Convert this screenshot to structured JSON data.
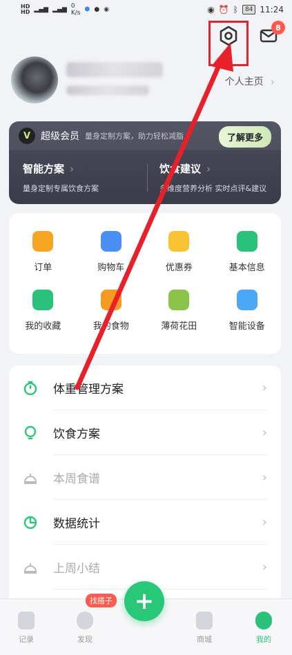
{
  "status_bar": {
    "time": "11:24",
    "battery": "84",
    "net_speed": "0",
    "net_unit": "K/s"
  },
  "header": {
    "mail_badge": "8"
  },
  "profile": {
    "home_link": "个人主页"
  },
  "vip": {
    "logo": "V",
    "title": "超级会员",
    "subtitle": "量身定制方案，助力轻松减脂",
    "more_label": "了解更多",
    "left_heading": "智能方案",
    "left_sub": "量身定制专属饮食方案",
    "right_heading": "饮食建议",
    "right_sub": "多维度营养分析 实时点评&建议"
  },
  "grid": {
    "items": [
      {
        "label": "订单",
        "icon": "order-icon",
        "color": "#f5a623"
      },
      {
        "label": "购物车",
        "icon": "cart-icon",
        "color": "#4a8ff5"
      },
      {
        "label": "优惠券",
        "icon": "coupon-icon",
        "color": "#f7c233"
      },
      {
        "label": "基本信息",
        "icon": "profile-info-icon",
        "color": "#2ac17a"
      },
      {
        "label": "我的收藏",
        "icon": "favorites-icon",
        "color": "#2ac17a"
      },
      {
        "label": "我的食物",
        "icon": "food-icon",
        "color": "#f59a23"
      },
      {
        "label": "薄荷花田",
        "icon": "garden-icon",
        "color": "#8bc34a"
      },
      {
        "label": "智能设备",
        "icon": "device-icon",
        "color": "#4aa8f5"
      }
    ]
  },
  "menu": {
    "items": [
      {
        "label": "体重管理方案",
        "icon": "timer-icon",
        "dim": false
      },
      {
        "label": "饮食方案",
        "icon": "bulb-icon",
        "dim": false
      },
      {
        "label": "本周食谱",
        "icon": "dish-icon",
        "dim": true
      },
      {
        "label": "数据统计",
        "icon": "pie-chart-icon",
        "dim": false
      },
      {
        "label": "上周小结",
        "icon": "dish-icon",
        "dim": true
      }
    ]
  },
  "tabs": {
    "record": "记录",
    "discover": "发现",
    "discover_badge": "找搭子",
    "shop": "商城",
    "mine": "我的",
    "fab_label": "+"
  },
  "colors": {
    "accent": "#29c778",
    "annotation": "#e8202a"
  }
}
